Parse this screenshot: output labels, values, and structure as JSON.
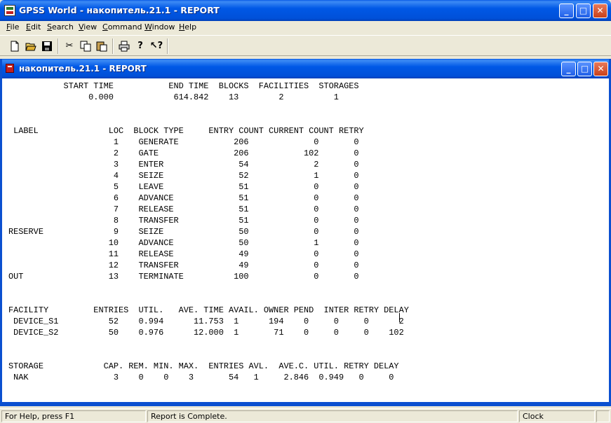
{
  "app": {
    "title": "GPSS World - накопитель.21.1  - REPORT"
  },
  "menu": [
    {
      "label": "File",
      "key": "F",
      "rest": "ile"
    },
    {
      "label": "Edit",
      "key": "E",
      "rest": "dit"
    },
    {
      "label": "Search",
      "key": "S",
      "rest": "earch"
    },
    {
      "label": "View",
      "key": "V",
      "rest": "iew"
    },
    {
      "label": "Command",
      "key": "C",
      "rest": "ommand"
    },
    {
      "label": "Window",
      "key": "W",
      "rest": "indow"
    },
    {
      "label": "Help",
      "key": "H",
      "rest": "elp"
    }
  ],
  "toolbar": {
    "buttons": [
      "new-icon",
      "open-icon",
      "save-icon",
      "cut-icon",
      "copy-icon",
      "paste-icon",
      "print-icon",
      "help-icon",
      "context-help-icon"
    ]
  },
  "child_window": {
    "title": "накопитель.21.1  -  REPORT"
  },
  "report": {
    "header_labels": "           START TIME           END TIME  BLOCKS  FACILITIES  STORAGES",
    "header_values": "                0.000            614.842    13        2          1",
    "blocks_header": " LABEL              LOC  BLOCK TYPE     ENTRY COUNT CURRENT COUNT RETRY",
    "blocks": [
      "                     1    GENERATE           206             0       0",
      "                     2    GATE               206           102       0",
      "                     3    ENTER               54             2       0",
      "                     4    SEIZE               52             1       0",
      "                     5    LEAVE               51             0       0",
      "                     6    ADVANCE             51             0       0",
      "                     7    RELEASE             51             0       0",
      "                     8    TRANSFER            51             0       0",
      "RESERVE              9    SEIZE               50             0       0",
      "                    10    ADVANCE             50             1       0",
      "                    11    RELEASE             49             0       0",
      "                    12    TRANSFER            49             0       0",
      "OUT                 13    TERMINATE          100             0       0"
    ],
    "facility_header": "FACILITY         ENTRIES  UTIL.   AVE. TIME AVAIL. OWNER PEND  INTER RETRY DELAY",
    "facilities": [
      " DEVICE_S1          52    0.994      11.753  1      194    0     0     0      2",
      " DEVICE_S2          50    0.976      12.000  1       71    0     0     0    102"
    ],
    "storage_header": "STORAGE            CAP. REM. MIN. MAX.  ENTRIES AVL.  AVE.C. UTIL. RETRY DELAY",
    "storages": [
      " NAK                 3    0    0    3       54   1     2.846  0.949   0     0"
    ]
  },
  "status": {
    "help": "For Help, press F1",
    "message": "Report is Complete.",
    "clock": "Clock",
    "extra": ""
  }
}
